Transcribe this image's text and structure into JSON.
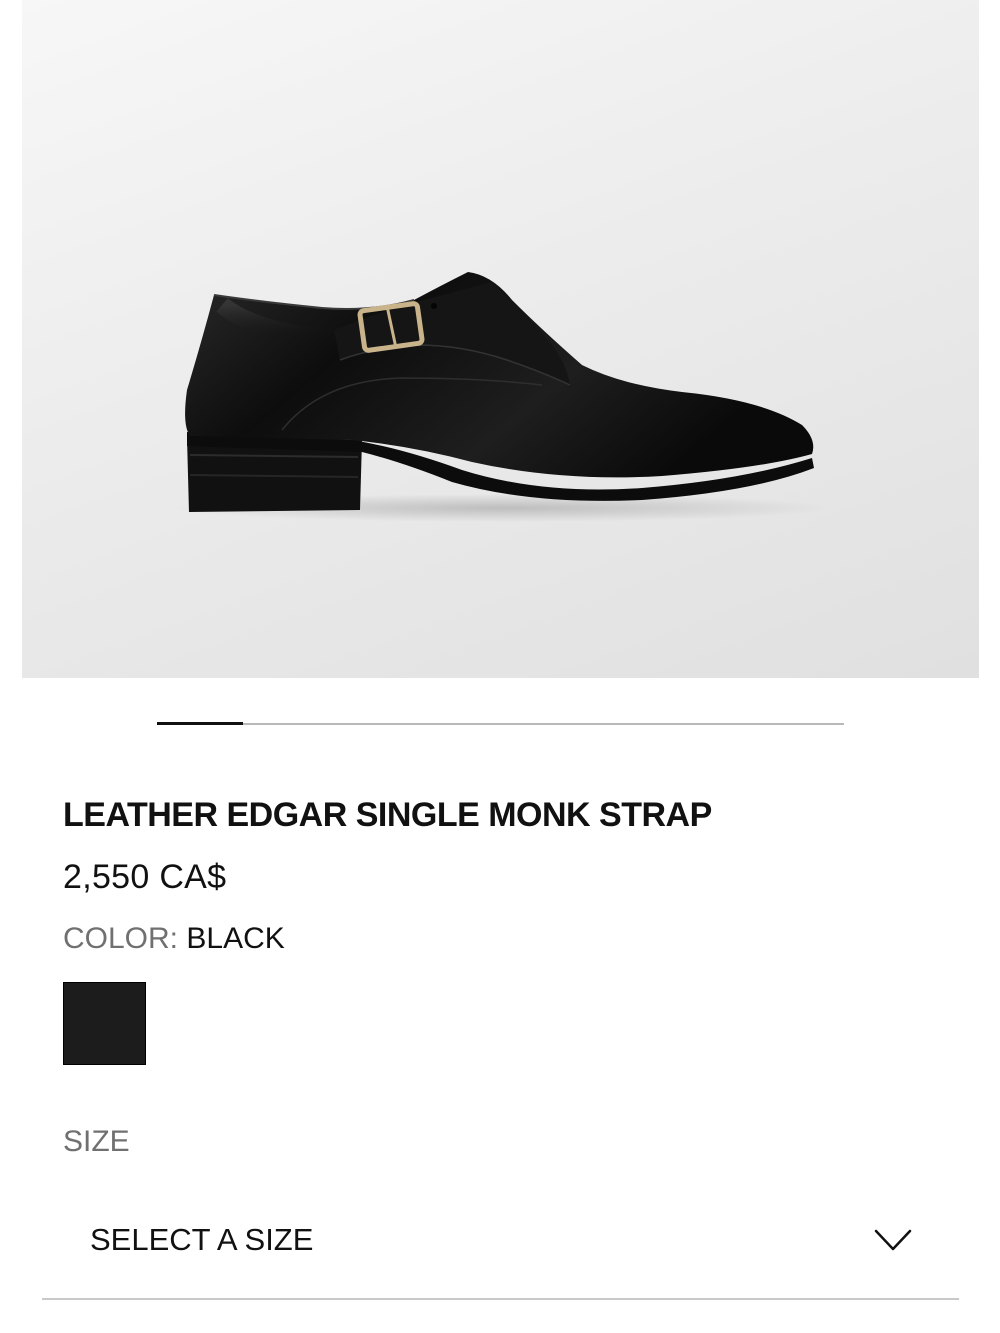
{
  "product": {
    "image_alt": "Leather Edgar single monk strap shoe",
    "title": "LEATHER EDGAR SINGLE MONK STRAP",
    "price": "2,550 CA$"
  },
  "carousel": {
    "current": 1,
    "total": 8
  },
  "color": {
    "label": "COLOR:",
    "value": "BLACK",
    "swatches": [
      {
        "name": "BLACK",
        "hex": "#1c1c1c",
        "selected": true
      }
    ]
  },
  "size": {
    "label": "SIZE",
    "select_placeholder": "SELECT A SIZE",
    "icon": "chevron-down-icon"
  }
}
